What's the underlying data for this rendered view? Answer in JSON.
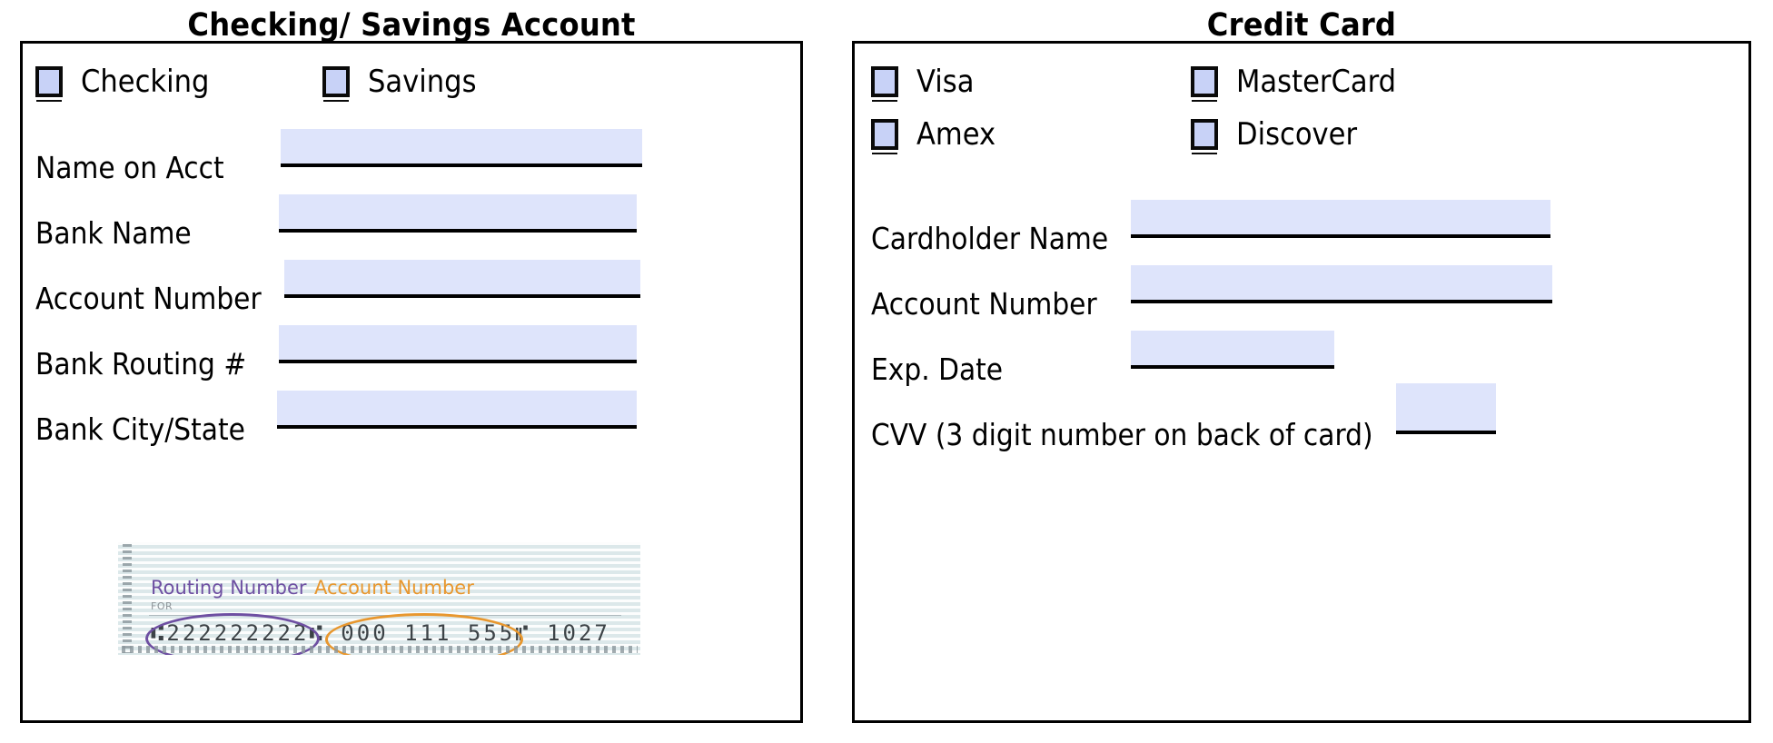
{
  "document": {
    "type": "payment-authorization-form"
  },
  "colors": {
    "checkbox_fill": "#c8d2f7",
    "input_fill": "#dee4fb",
    "border": "#000000",
    "routing_accent": "#6e4fa2",
    "account_accent": "#e8972e",
    "check_paper": "#eef3f4"
  },
  "left_panel": {
    "title": "Checking/ Savings Account",
    "checkboxes": [
      {
        "label": "Checking",
        "checked": false
      },
      {
        "label": "Savings",
        "checked": false
      }
    ],
    "fields": [
      {
        "label": "Name on Acct",
        "value": "",
        "placeholder": ""
      },
      {
        "label": "Bank Name",
        "value": "",
        "placeholder": ""
      },
      {
        "label": "Account Number",
        "value": "",
        "placeholder": ""
      },
      {
        "label": "Bank Routing #",
        "value": "",
        "placeholder": ""
      },
      {
        "label": "Bank City/State",
        "value": "",
        "placeholder": ""
      }
    ],
    "check_illustration": {
      "routing_caption": "Routing Number",
      "account_caption": "Account Number",
      "for_label": "FOR",
      "micr_routing": "⑆222222222⑆",
      "micr_account": "000 111 555⑈",
      "micr_trailing": "1027",
      "micr_full_line": "⑆222222222⑆ 000 111 555⑈ 1027"
    }
  },
  "right_panel": {
    "title": "Credit Card",
    "checkboxes": [
      {
        "label": "Visa",
        "checked": false
      },
      {
        "label": "MasterCard",
        "checked": false
      },
      {
        "label": "Amex",
        "checked": false
      },
      {
        "label": "Discover",
        "checked": false
      }
    ],
    "fields": [
      {
        "label": "Cardholder Name",
        "value": "",
        "placeholder": ""
      },
      {
        "label": "Account Number",
        "value": "",
        "placeholder": ""
      },
      {
        "label": "Exp. Date",
        "value": "",
        "placeholder": ""
      },
      {
        "label": "CVV (3 digit number on back of card)",
        "value": "",
        "placeholder": ""
      }
    ]
  }
}
